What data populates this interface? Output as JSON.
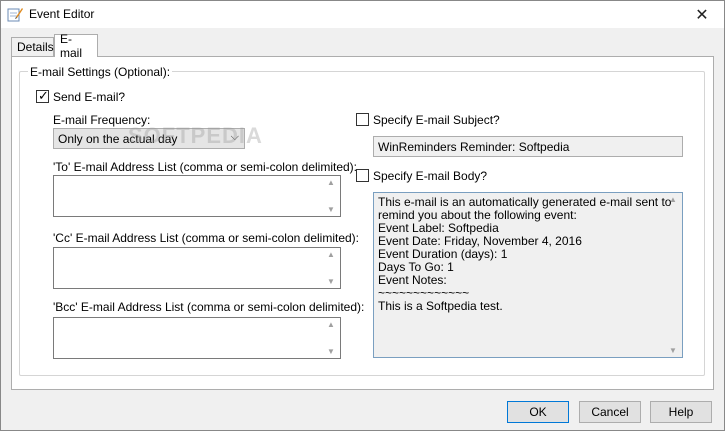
{
  "window": {
    "title": "Event Editor",
    "close_glyph": "✕"
  },
  "tabs": [
    {
      "label": "Details",
      "active": false
    },
    {
      "label": "E-mail",
      "active": true
    }
  ],
  "email_settings": {
    "group_label": "E-mail Settings (Optional):",
    "send_email": {
      "label": "Send E-mail?",
      "checked": true
    },
    "frequency": {
      "label": "E-mail Frequency:",
      "value": "Only on the actual day"
    },
    "to_list": {
      "label": "'To' E-mail Address List (comma or semi-colon delimited):",
      "value": ""
    },
    "cc_list": {
      "label": "'Cc' E-mail Address List  (comma or semi-colon delimited):",
      "value": ""
    },
    "bcc_list": {
      "label": "'Bcc' E-mail Address List  (comma or semi-colon delimited):",
      "value": ""
    },
    "specify_subject": {
      "label": "Specify E-mail Subject?",
      "checked": false
    },
    "subject_value": "WinReminders Reminder: Softpedia",
    "specify_body": {
      "label": "Specify E-mail Body?",
      "checked": false
    },
    "body_lines": [
      "This e-mail is an automatically generated e-mail sent to",
      "remind you about the following event:",
      "Event Label: Softpedia",
      "Event Date: Friday, November 4, 2016",
      "Event Duration (days): 1",
      "Days To Go: 1",
      "Event Notes:",
      "~~~~~~~~~~~~~",
      "This is a Softpedia test."
    ]
  },
  "buttons": {
    "ok": "OK",
    "cancel": "Cancel",
    "help": "Help"
  },
  "watermark": "SOFTPEDIA",
  "colors": {
    "accent": "#0078d7",
    "panel": "#ffffff",
    "chrome": "#f0f0f0"
  }
}
